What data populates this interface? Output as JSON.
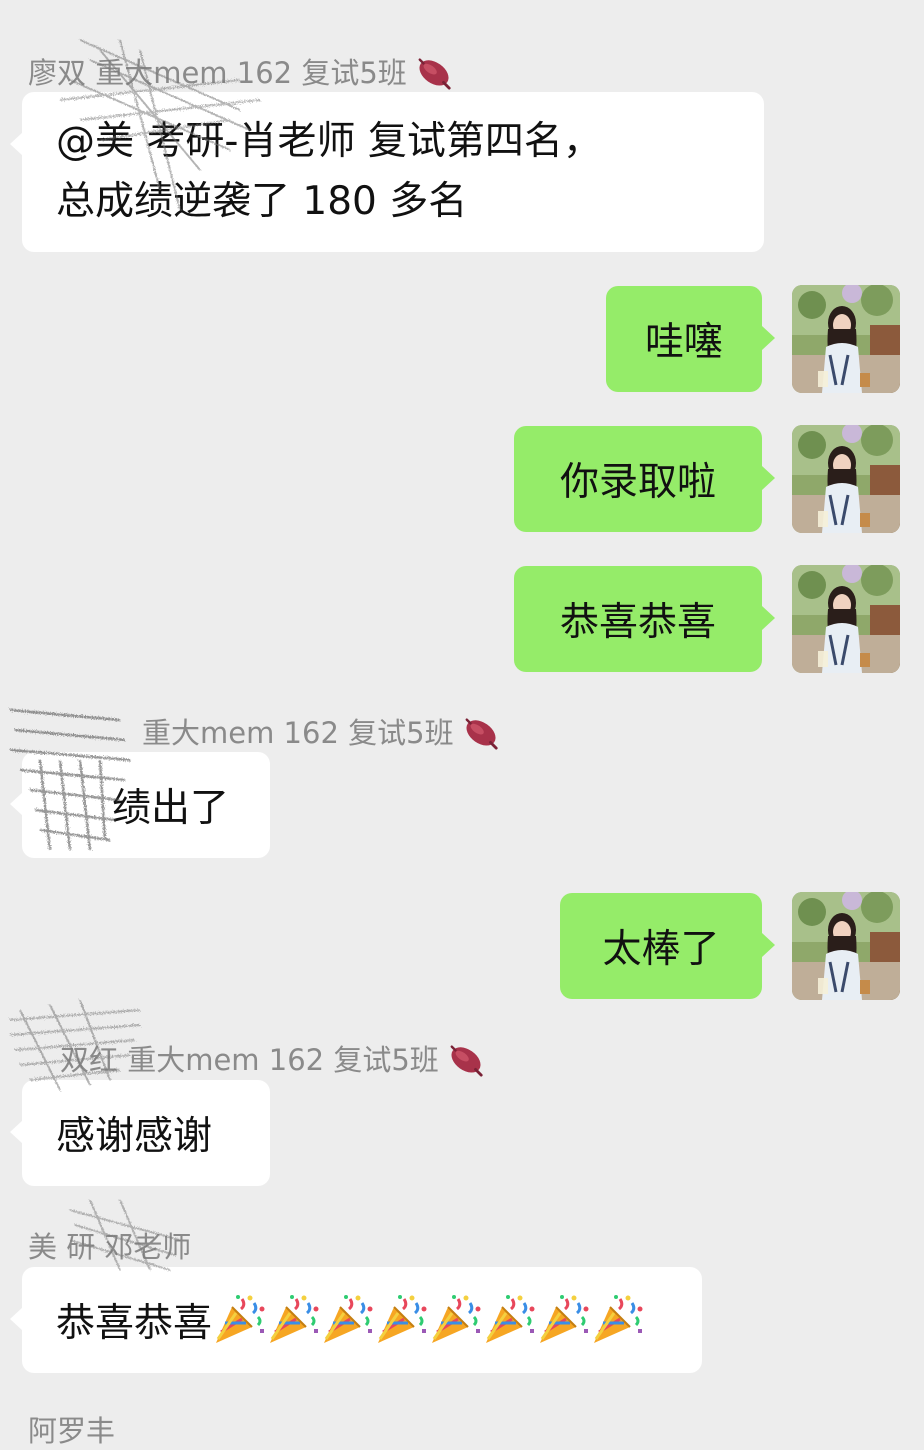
{
  "messages": [
    {
      "sender": "廖双  重大mem 162 复试5班",
      "text_lines": [
        "@美  考研-肖老师  复试第四名，",
        "总成绩逆袭了 180 多名"
      ],
      "side": "in"
    },
    {
      "text": "哇噻",
      "side": "out"
    },
    {
      "text": "你录取啦",
      "side": "out"
    },
    {
      "text": "恭喜恭喜",
      "side": "out"
    },
    {
      "sender": "重大mem 162 复试5班",
      "text": "绩出了",
      "side": "in"
    },
    {
      "text": "太棒了",
      "side": "out"
    },
    {
      "sender": "双红  重大mem 162 复试5班",
      "text": "感谢感谢",
      "side": "in"
    },
    {
      "sender": "美  研 邓老师",
      "text": "恭喜恭喜",
      "party_count": 8,
      "side": "in"
    },
    {
      "sender": "阿罗丰",
      "side": "in"
    }
  ],
  "icons": {
    "sender_badge": "sweet-potato-icon",
    "celebration": "party-popper-icon"
  },
  "colors": {
    "background": "#ededed",
    "outgoing_bubble": "#95ec69",
    "incoming_bubble": "#ffffff"
  }
}
